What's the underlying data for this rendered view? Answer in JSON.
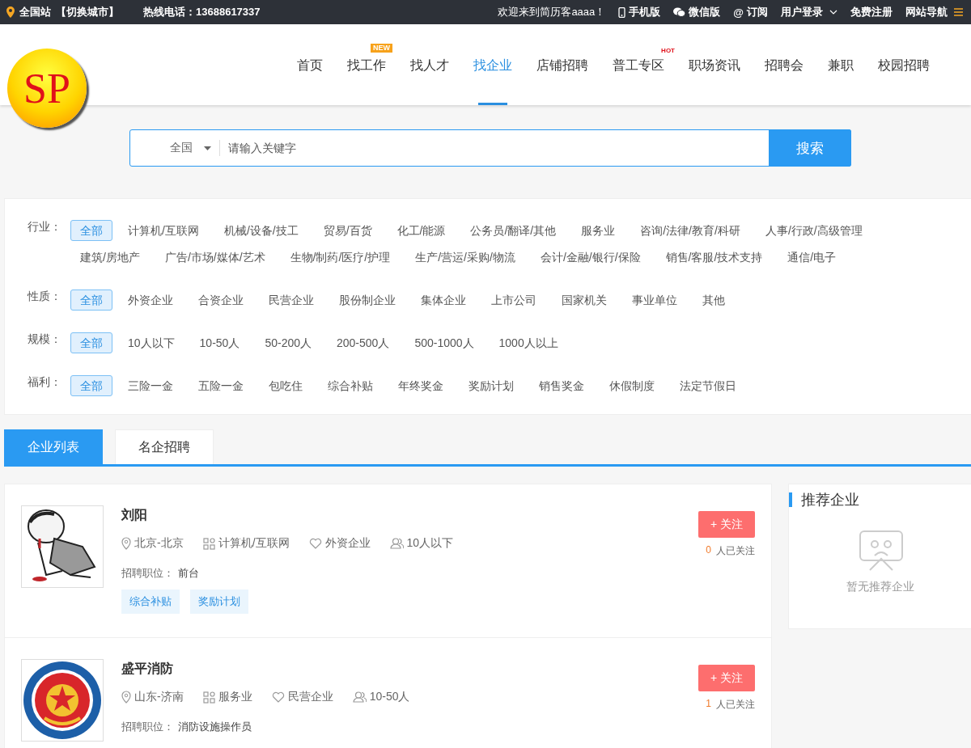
{
  "top_bar": {
    "location": "全国站",
    "switch_city": "【切换城市】",
    "hotline": "热线电话：13688617337",
    "welcome": "欢迎来到简历客aaaa！",
    "links": [
      {
        "label": "手机版",
        "kind": "phone"
      },
      {
        "label": "微信版",
        "kind": "wechat"
      },
      {
        "label": "订阅",
        "kind": "at",
        "icon": "@"
      },
      {
        "label": "用户登录",
        "kind": "dropdown"
      },
      {
        "label": "免费注册",
        "kind": "plain"
      },
      {
        "label": "网站导航",
        "kind": "menu"
      }
    ]
  },
  "header": {
    "logo": "SP",
    "nav": [
      {
        "label": "首页",
        "selected": false
      },
      {
        "label": "找工作",
        "selected": false,
        "badge": {
          "text": "NEW",
          "kind": "new"
        }
      },
      {
        "label": "找人才",
        "selected": false
      },
      {
        "label": "找企业",
        "selected": true
      },
      {
        "label": "店铺招聘",
        "selected": false
      },
      {
        "label": "普工专区",
        "selected": false,
        "badge": {
          "text": "HOT",
          "kind": "hot"
        }
      },
      {
        "label": "职场资讯",
        "selected": false
      },
      {
        "label": "招聘会",
        "selected": false
      },
      {
        "label": "兼职",
        "selected": false
      },
      {
        "label": "校园招聘",
        "selected": false
      }
    ]
  },
  "search": {
    "region": "全国",
    "placeholder": "请输入关键字",
    "button": "搜索"
  },
  "filters": [
    {
      "label": "行业：",
      "options": [
        {
          "label": "全部",
          "selected": true
        },
        {
          "label": "计算机/互联网",
          "selected": false
        },
        {
          "label": "机械/设备/技工",
          "selected": false
        },
        {
          "label": "贸易/百货",
          "selected": false
        },
        {
          "label": "化工/能源",
          "selected": false
        },
        {
          "label": "公务员/翻译/其他",
          "selected": false
        },
        {
          "label": "服务业",
          "selected": false
        },
        {
          "label": "咨询/法律/教育/科研",
          "selected": false
        },
        {
          "label": "人事/行政/高级管理",
          "selected": false
        },
        {
          "label": "建筑/房地产",
          "selected": false
        },
        {
          "label": "广告/市场/媒体/艺术",
          "selected": false
        },
        {
          "label": "生物/制药/医疗/护理",
          "selected": false
        },
        {
          "label": "生产/营运/采购/物流",
          "selected": false
        },
        {
          "label": "会计/金融/银行/保险",
          "selected": false
        },
        {
          "label": "销售/客服/技术支持",
          "selected": false
        },
        {
          "label": "通信/电子",
          "selected": false
        }
      ]
    },
    {
      "label": "性质：",
      "options": [
        {
          "label": "全部",
          "selected": true
        },
        {
          "label": "外资企业",
          "selected": false
        },
        {
          "label": "合资企业",
          "selected": false
        },
        {
          "label": "民营企业",
          "selected": false
        },
        {
          "label": "股份制企业",
          "selected": false
        },
        {
          "label": "集体企业",
          "selected": false
        },
        {
          "label": "上市公司",
          "selected": false
        },
        {
          "label": "国家机关",
          "selected": false
        },
        {
          "label": "事业单位",
          "selected": false
        },
        {
          "label": "其他",
          "selected": false
        }
      ]
    },
    {
      "label": "规模：",
      "options": [
        {
          "label": "全部",
          "selected": true
        },
        {
          "label": "10人以下",
          "selected": false
        },
        {
          "label": "10-50人",
          "selected": false
        },
        {
          "label": "50-200人",
          "selected": false
        },
        {
          "label": "200-500人",
          "selected": false
        },
        {
          "label": "500-1000人",
          "selected": false
        },
        {
          "label": "1000人以上",
          "selected": false
        }
      ]
    },
    {
      "label": "福利：",
      "options": [
        {
          "label": "全部",
          "selected": true
        },
        {
          "label": "三险一金",
          "selected": false
        },
        {
          "label": "五险一金",
          "selected": false
        },
        {
          "label": "包吃住",
          "selected": false
        },
        {
          "label": "综合补贴",
          "selected": false
        },
        {
          "label": "年终奖金",
          "selected": false
        },
        {
          "label": "奖励计划",
          "selected": false
        },
        {
          "label": "销售奖金",
          "selected": false
        },
        {
          "label": "休假制度",
          "selected": false
        },
        {
          "label": "法定节假日",
          "selected": false
        }
      ]
    }
  ],
  "tabs": [
    {
      "label": "企业列表",
      "selected": true
    },
    {
      "label": "名企招聘",
      "selected": false
    }
  ],
  "companies": [
    {
      "name": "刘阳",
      "location": "北京-北京",
      "industry": "计算机/互联网",
      "nature": "外资企业",
      "size": "10人以下",
      "position_label": "招聘职位：",
      "position": "前台",
      "tags": [
        "综合补贴",
        "奖励计划"
      ],
      "follow_button": "+ 关注",
      "followers_count": "0",
      "followers_text": "人已关注"
    },
    {
      "name": "盛平消防",
      "location": "山东-济南",
      "industry": "服务业",
      "nature": "民营企业",
      "size": "10-50人",
      "position_label": "招聘职位：",
      "position": "消防设施操作员",
      "follow_button": "+ 关注",
      "followers_count": "1",
      "followers_text": "人已关注"
    }
  ],
  "sidebar": {
    "title": "推荐企业",
    "empty_text": "暂无推荐企业"
  }
}
